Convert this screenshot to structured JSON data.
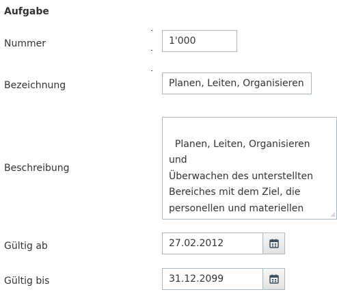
{
  "section": {
    "title": "Aufgabe"
  },
  "fields": {
    "nummer": {
      "label": "Nummer",
      "value": "1'000"
    },
    "bezeichnung": {
      "label": "Bezeichnung",
      "value": "Planen, Leiten, Organisieren"
    },
    "beschreibung": {
      "label": "Beschreibung",
      "value": "Planen, Leiten, Organisieren und\nÜberwachen des unterstellten\nBereiches mit dem Ziel, die\npersonellen und materiellen\nRessourcen optimal zu nutzen"
    },
    "gueltig_ab": {
      "label": "Gültig ab",
      "value": "27.02.2012",
      "icon": "calendar-icon"
    },
    "gueltig_bis": {
      "label": "Gültig bis",
      "value": "31.12.2099",
      "icon": "calendar-icon"
    }
  },
  "colors": {
    "text": "#333333",
    "border": "#aab8c2",
    "button_bg": "#e9e9e9",
    "icon": "#3d4f5c"
  }
}
